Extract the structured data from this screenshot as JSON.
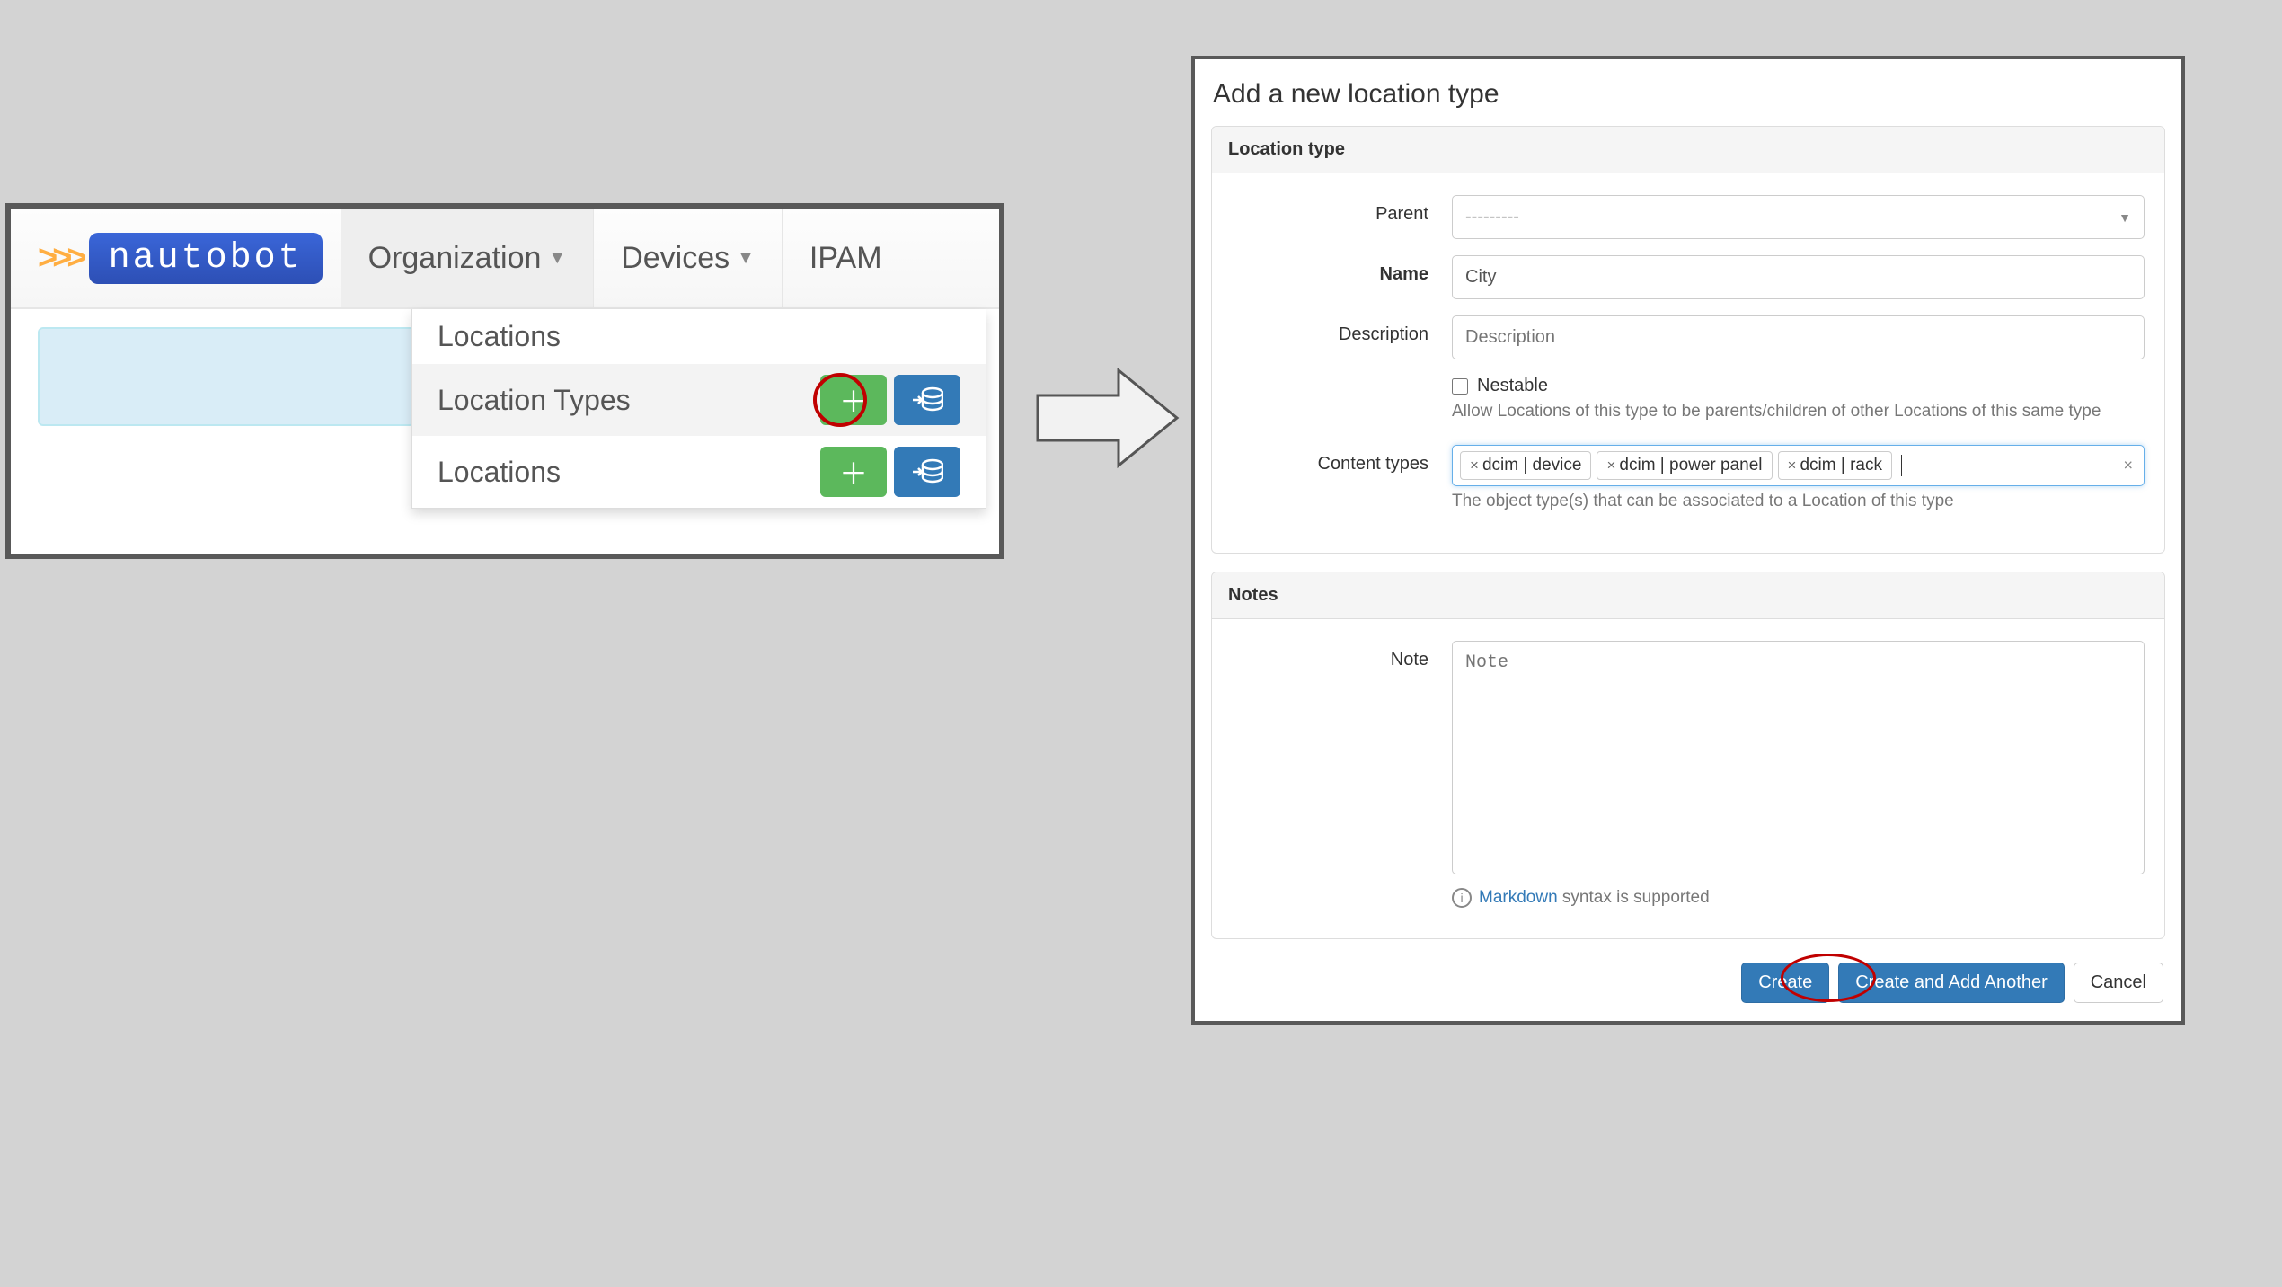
{
  "brand": {
    "chevrons": ">>>",
    "name": "nautobot"
  },
  "nav": {
    "organization": "Organization",
    "devices": "Devices",
    "ipam": "IPAM"
  },
  "dropdown": {
    "locations1": "Locations",
    "location_types": "Location Types",
    "locations2": "Locations"
  },
  "form": {
    "title": "Add a new location type",
    "section_location_type": "Location type",
    "section_notes": "Notes",
    "labels": {
      "parent": "Parent",
      "name": "Name",
      "description": "Description",
      "content_types": "Content types",
      "note": "Note"
    },
    "parent_placeholder": "---------",
    "name_value": "City",
    "description_placeholder": "Description",
    "nestable_label": "Nestable",
    "nestable_help": "Allow Locations of this type to be parents/children of other Locations of this same type",
    "content_types": [
      "dcim | device",
      "dcim | power panel",
      "dcim | rack"
    ],
    "content_types_help": "The object type(s) that can be associated to a Location of this type",
    "note_placeholder": "Note",
    "markdown_link": "Markdown",
    "markdown_suffix": " syntax is supported",
    "buttons": {
      "create": "Create",
      "create_another": "Create and Add Another",
      "cancel": "Cancel"
    }
  }
}
